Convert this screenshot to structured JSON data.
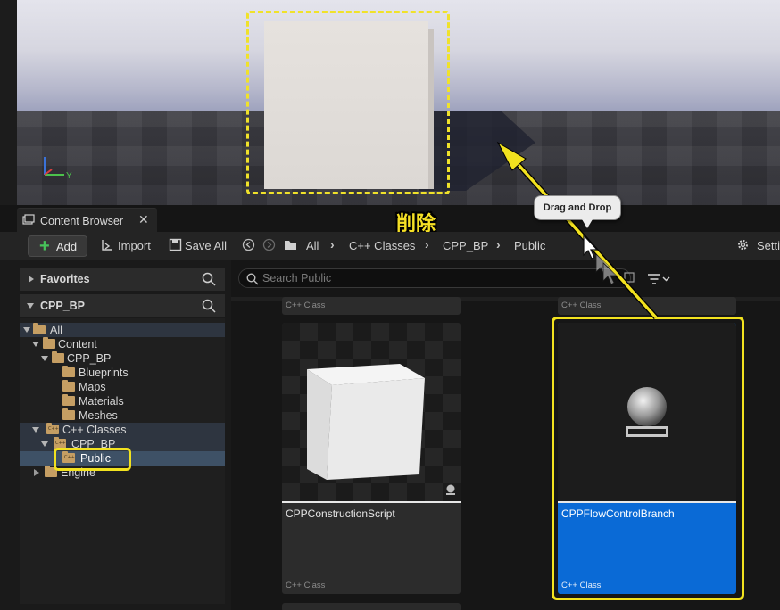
{
  "tab": {
    "title": "Content Browser",
    "close": "✕"
  },
  "annotation": {
    "delete_label": "削除",
    "drag_label": "Drag and Drop"
  },
  "toolbar": {
    "add_label": "Add",
    "import_label": "Import",
    "save_all_label": "Save All",
    "settings_label": "Setti",
    "breadcrumbs": [
      "All",
      "C++ Classes",
      "CPP_BP",
      "Public"
    ]
  },
  "sidebar": {
    "favorites_label": "Favorites",
    "project_label": "CPP_BP",
    "tree": [
      {
        "label": "All"
      },
      {
        "label": "Content"
      },
      {
        "label": "CPP_BP"
      },
      {
        "label": "Blueprints"
      },
      {
        "label": "Maps"
      },
      {
        "label": "Materials"
      },
      {
        "label": "Meshes"
      },
      {
        "label": "C++ Classes"
      },
      {
        "label": "CPP_BP"
      },
      {
        "label": "Public"
      },
      {
        "label": "Engine"
      }
    ]
  },
  "search": {
    "placeholder": "Search Public"
  },
  "assets": [
    {
      "name": "",
      "type": "C++ Class"
    },
    {
      "name": "",
      "type": "C++ Class"
    },
    {
      "name": "CPPConstructionScript",
      "type": "C++ Class"
    },
    {
      "name": "CPPFlowControlBranch",
      "type": "C++ Class"
    }
  ],
  "viewport": {
    "axis_y_label": "Y"
  },
  "colors": {
    "highlight": "#f2e21f",
    "selected_card": "#0a6ad6",
    "folder": "#c59e63",
    "add_plus": "#47c35a"
  },
  "icons": [
    "content-browser-icon",
    "plus-icon",
    "import-icon",
    "save-icon",
    "back-icon",
    "forward-icon",
    "folder-icon",
    "chevron-right-icon",
    "gear-icon",
    "search-icon",
    "filter-icon",
    "mouse-cursor-icon",
    "arrow-annotation"
  ]
}
